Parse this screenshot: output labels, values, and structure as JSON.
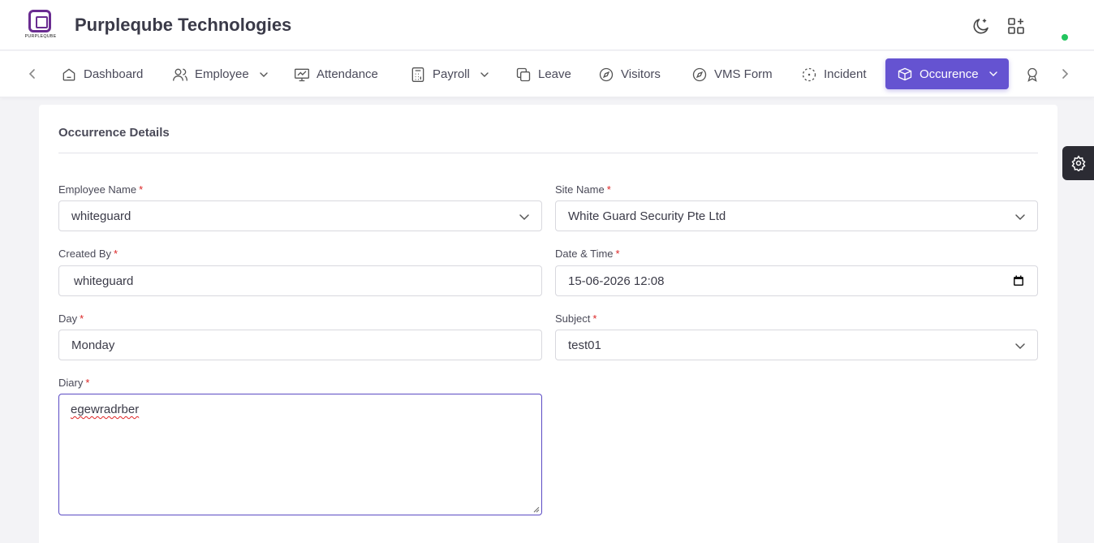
{
  "header": {
    "company_name": "Purpleqube Technologies",
    "logo_text": "PURPLEQUBE",
    "brand_color": "#6a2c91",
    "online_status_color": "#22c55e",
    "icons": [
      "moon-icon",
      "apps-grid-icon"
    ]
  },
  "nav": {
    "items": [
      {
        "label": "Dashboard",
        "icon": "home-icon",
        "dropdown": false
      },
      {
        "label": "Employee",
        "icon": "users-icon",
        "dropdown": true
      },
      {
        "label": "Attendance",
        "icon": "monitor-chart-icon",
        "dropdown": false
      },
      {
        "label": "Payroll",
        "icon": "calculator-icon",
        "dropdown": true
      },
      {
        "label": "Leave",
        "icon": "copy-icon",
        "dropdown": false
      },
      {
        "label": "Visitors",
        "icon": "compass-icon",
        "dropdown": false
      },
      {
        "label": "VMS Form",
        "icon": "compass-icon",
        "dropdown": false
      },
      {
        "label": "Incident",
        "icon": "focus-icon",
        "dropdown": false
      },
      {
        "label": "Occurence",
        "icon": "box-icon",
        "dropdown": true,
        "active": true
      }
    ],
    "active_color": "#6553d1"
  },
  "form": {
    "title": "Occurrence Details",
    "employee_name": {
      "label": "Employee Name",
      "value": "whiteguard"
    },
    "site_name": {
      "label": "Site Name",
      "value": "White Guard Security Pte Ltd"
    },
    "created_by": {
      "label": "Created By",
      "value": "whiteguard"
    },
    "date_time": {
      "label": "Date & Time",
      "value": "15-06-2026 12:08"
    },
    "day": {
      "label": "Day",
      "value": "Monday"
    },
    "subject": {
      "label": "Subject",
      "value": "test01"
    },
    "diary": {
      "label": "Diary",
      "value": "egewradrber"
    },
    "required_mark": "*"
  }
}
